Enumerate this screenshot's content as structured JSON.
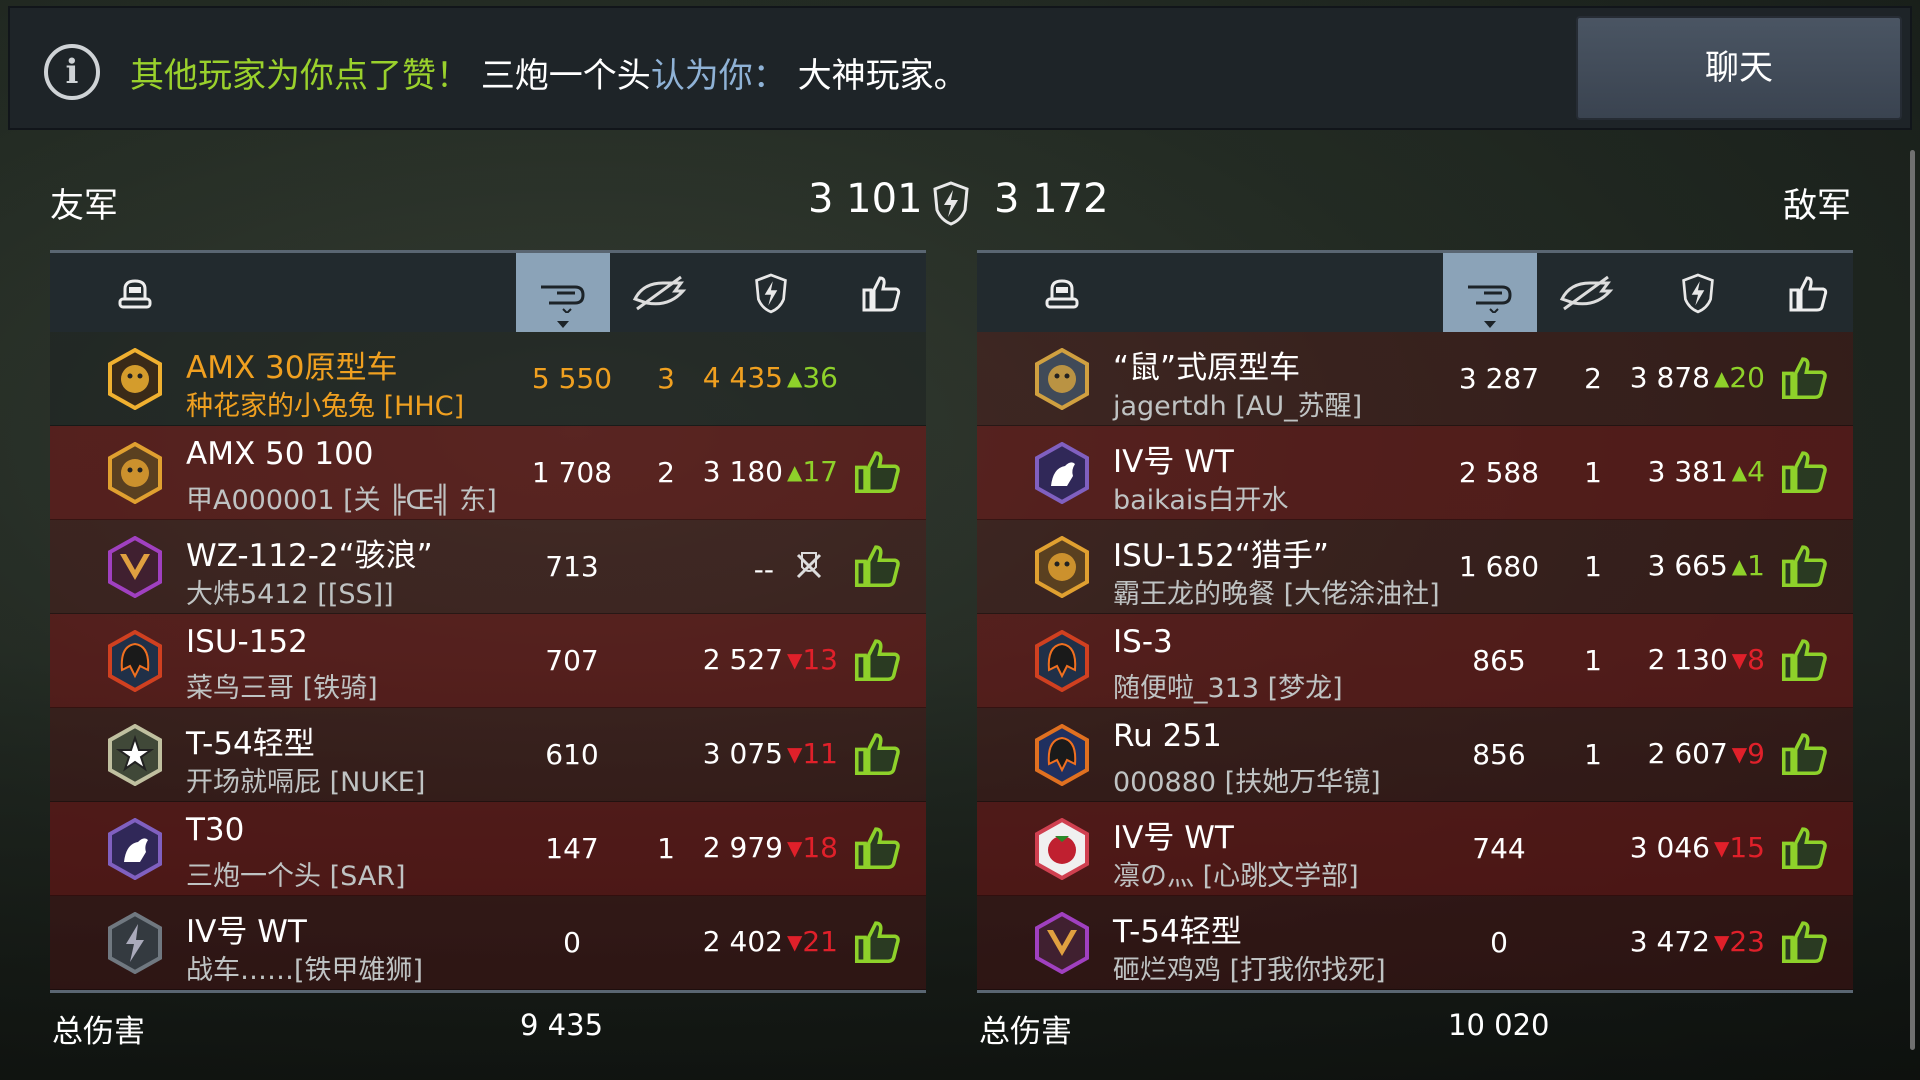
{
  "notification": {
    "part1": "其他玩家为你点了赞！",
    "part2": "三炮一个头",
    "part3": "认为你：",
    "part4": "大神玩家。",
    "info_icon": "info-icon",
    "chat_label": "聊天"
  },
  "header": {
    "ally_label": "友军",
    "enemy_label": "敌军",
    "ally_score": "3 101",
    "enemy_score": "3 172",
    "center_icon": "rating-shield-icon"
  },
  "columns": [
    "tank-icon",
    "damage-icon",
    "kills-icon",
    "rating-icon",
    "like-icon"
  ],
  "allies": [
    {
      "tank": "AMX 30原型车",
      "player": "种花家的小兔兔 [HHC]",
      "damage": "5 550",
      "kills": "3",
      "rating": "4 435",
      "dir": "up",
      "delta": "36",
      "badge": "bull",
      "highlight": true,
      "like": false
    },
    {
      "tank": "AMX 50 100",
      "player": "甲A000001 [关 ╠Œ╣ 东]",
      "damage": "1 708",
      "kills": "2",
      "rating": "3 180",
      "dir": "up",
      "delta": "17",
      "badge": "bear",
      "highlight": false,
      "like": true
    },
    {
      "tank": "WZ-112-2“骇浪”",
      "player": "大炜5412 [[SS]]",
      "damage": "713",
      "kills": "",
      "rating": "--",
      "dir": "destroyed",
      "delta": "",
      "badge": "chevron",
      "highlight": false,
      "like": true
    },
    {
      "tank": "ISU-152",
      "player": "菜鸟三哥 [铁骑]",
      "damage": "707",
      "kills": "",
      "rating": "2 527",
      "dir": "down",
      "delta": "13",
      "badge": "helmet",
      "highlight": false,
      "like": true
    },
    {
      "tank": "T-54轻型",
      "player": "开场就嗝屁 [NUKE]",
      "damage": "610",
      "kills": "",
      "rating": "3 075",
      "dir": "down",
      "delta": "11",
      "badge": "star",
      "highlight": false,
      "like": true
    },
    {
      "tank": "T30",
      "player": "三炮一个头 [SAR]",
      "damage": "147",
      "kills": "1",
      "rating": "2 979",
      "dir": "down",
      "delta": "18",
      "badge": "kangaroo",
      "highlight": false,
      "like": true
    },
    {
      "tank": "IV号 WT",
      "player": "战车……[铁甲雄狮]",
      "damage": "0",
      "kills": "",
      "rating": "2 402",
      "dir": "down",
      "delta": "21",
      "badge": "bolt",
      "highlight": false,
      "like": true
    }
  ],
  "enemies": [
    {
      "tank": "“鼠”式原型车",
      "player": "jagertdh [AU_苏醒]",
      "damage": "3 287",
      "kills": "2",
      "rating": "3 878",
      "dir": "up",
      "delta": "20",
      "badge": "eagle",
      "like": true
    },
    {
      "tank": "IV号 WT",
      "player": "baikais白开水",
      "damage": "2 588",
      "kills": "1",
      "rating": "3 381",
      "dir": "up",
      "delta": "4",
      "badge": "kangaroo",
      "like": true
    },
    {
      "tank": "ISU-152“猎手”",
      "player": "霸王龙的晚餐 [大佬涂油社]",
      "damage": "1 680",
      "kills": "1",
      "rating": "3 665",
      "dir": "up",
      "delta": "1",
      "badge": "bear",
      "like": true
    },
    {
      "tank": "IS-3",
      "player": "随便啦_313 [梦龙]",
      "damage": "865",
      "kills": "1",
      "rating": "2 130",
      "dir": "down",
      "delta": "8",
      "badge": "helmet",
      "like": true
    },
    {
      "tank": "Ru 251",
      "player": "000880 [扶她万华镜]",
      "damage": "856",
      "kills": "1",
      "rating": "2 607",
      "dir": "down",
      "delta": "9",
      "badge": "helmet2",
      "like": true
    },
    {
      "tank": "IV号 WT",
      "player": "凛の灬 [心跳文学部]",
      "damage": "744",
      "kills": "",
      "rating": "3 046",
      "dir": "down",
      "delta": "15",
      "badge": "strawberry",
      "like": true
    },
    {
      "tank": "T-54轻型",
      "player": "砸烂鸡鸡 [打我你找死]",
      "damage": "0",
      "kills": "",
      "rating": "3 472",
      "dir": "down",
      "delta": "23",
      "badge": "chevron",
      "like": true
    }
  ],
  "totals": {
    "label": "总伤害",
    "ally_total": "9 435",
    "enemy_total": "10 020"
  },
  "colors": {
    "highlight": "#f0a020",
    "up": "#8ed12a",
    "down": "#e0202a",
    "active_column": "#8ba3b8"
  }
}
